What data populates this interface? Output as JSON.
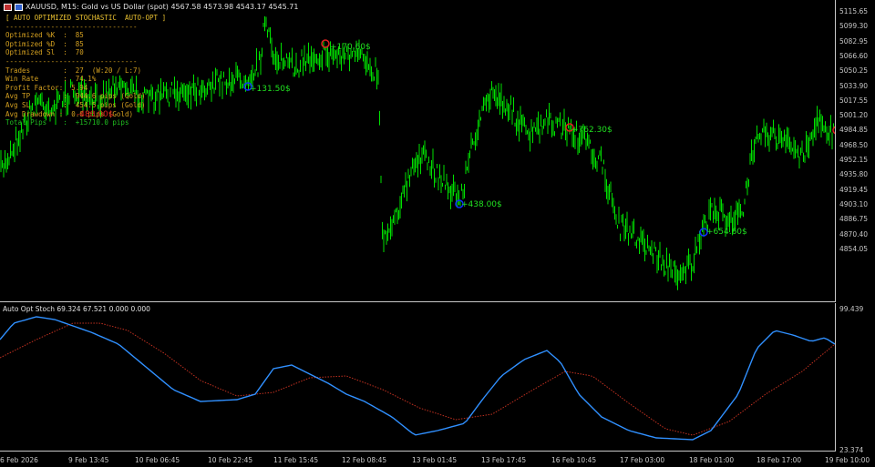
{
  "header": {
    "title": "XAUUSD, M15:  Gold vs US Dollar (spot)  4567.58 4573.98 4543.17 4545.71"
  },
  "panel": {
    "heading": "[ AUTO OPTIMIZED STOCHASTIC  AUTO-OPT ]",
    "separator": "--------------------------------",
    "lines": [
      "Optimized %K  :  85",
      "Optimized %D  :  85",
      "Optimized Sl  :  70"
    ],
    "stats": [
      "Trades        :  27  (W:20 / L:7)",
      "Win Rate      :  74.1%",
      "Profit Factor:  5.94",
      "Avg TP        :  944.6 pips (Gold)",
      "Avg SL        :  454.5 pips (Gold)",
      "Avg Drawdown :  0.0 pips (Gold)"
    ],
    "total": "Total Pips    :  +15710.0 pips"
  },
  "trades": [
    {
      "label": "+131.50$",
      "type": "buy"
    },
    {
      "label": "+170.60$",
      "type": "sell"
    },
    {
      "label": "+438.00$",
      "type": "buy"
    },
    {
      "label": "+762.30$",
      "type": "sell"
    },
    {
      "label": "+654.60$",
      "type": "buy"
    },
    {
      "label": "-488.00$",
      "type": "loss"
    }
  ],
  "price_axis": [
    "5115.65",
    "5099.30",
    "5082.95",
    "5066.60",
    "5050.25",
    "5033.90",
    "5017.55",
    "5001.20",
    "4984.85",
    "4968.50",
    "4952.15",
    "4935.80",
    "4919.45",
    "4903.10",
    "4886.75",
    "4870.40",
    "4854.05"
  ],
  "indicator": {
    "label": "Auto Opt Stoch 69.324 67.521 0.000 0.000",
    "max": "99.439",
    "min": "23.374"
  },
  "time_axis": [
    "6 Feb 2026",
    "9 Feb 13:45",
    "10 Feb 06:45",
    "10 Feb 22:45",
    "11 Feb 15:45",
    "12 Feb 08:45",
    "13 Feb 01:45",
    "13 Feb 17:45",
    "16 Feb 10:45",
    "17 Feb 03:00",
    "18 Feb 01:00",
    "18 Feb 17:00",
    "19 Feb 10:00"
  ],
  "colors": {
    "candles": "#00e000",
    "stoch_main": "#3090ff",
    "stoch_signal": "#c03020",
    "panel_text": "#d4a020",
    "buy_marker": "#1030ff",
    "sell_marker": "#e02020"
  }
}
